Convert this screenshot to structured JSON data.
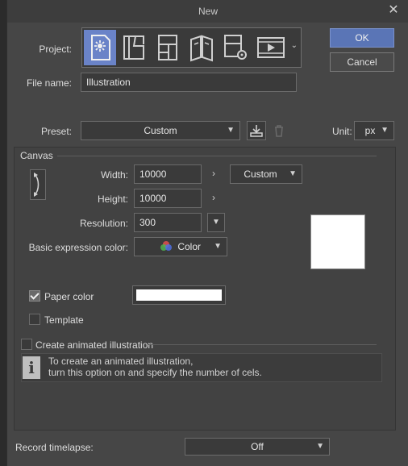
{
  "window": {
    "title": "New"
  },
  "buttons": {
    "ok": "OK",
    "cancel": "Cancel"
  },
  "project": {
    "label": "Project:",
    "items": [
      "illustration",
      "comic",
      "webtoon",
      "book",
      "custom-settings",
      "animation"
    ]
  },
  "file_name": {
    "label": "File name:",
    "value": "Illustration"
  },
  "preset": {
    "label": "Preset:",
    "value": "Custom"
  },
  "unit": {
    "label": "Unit:",
    "value": "px"
  },
  "canvas": {
    "section": "Canvas",
    "width_label": "Width:",
    "width_value": "10000",
    "size_preset": "Custom",
    "height_label": "Height:",
    "height_value": "10000",
    "resolution_label": "Resolution:",
    "resolution_value": "300",
    "expression_label": "Basic expression color:",
    "expression_value": "Color",
    "paper_color_label": "Paper color",
    "paper_color_checked": true,
    "paper_color": "#ffffff",
    "template_label": "Template",
    "template_checked": false
  },
  "animation": {
    "label": "Create animated illustration",
    "checked": false,
    "info_line1": "To create an animated illustration,",
    "info_line2": "turn this option on and specify the number of cels."
  },
  "timelapse": {
    "label": "Record timelapse:",
    "value": "Off"
  },
  "colors": {
    "accent": "#5a75b6",
    "background": "#464646"
  }
}
